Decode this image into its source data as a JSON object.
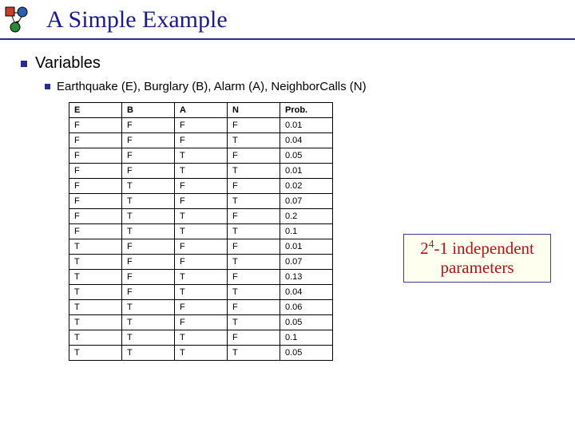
{
  "title": "A Simple Example",
  "bullets": {
    "level1": "Variables",
    "level2": "Earthquake (E), Burglary (B), Alarm (A), NeighborCalls (N)"
  },
  "table": {
    "headers": [
      "E",
      "B",
      "A",
      "N",
      "Prob."
    ],
    "rows": [
      [
        "F",
        "F",
        "F",
        "F",
        "0.01"
      ],
      [
        "F",
        "F",
        "F",
        "T",
        "0.04"
      ],
      [
        "F",
        "F",
        "T",
        "F",
        "0.05"
      ],
      [
        "F",
        "F",
        "T",
        "T",
        "0.01"
      ],
      [
        "F",
        "T",
        "F",
        "F",
        "0.02"
      ],
      [
        "F",
        "T",
        "F",
        "T",
        "0.07"
      ],
      [
        "F",
        "T",
        "T",
        "F",
        "0.2"
      ],
      [
        "F",
        "T",
        "T",
        "T",
        "0.1"
      ],
      [
        "T",
        "F",
        "F",
        "F",
        "0.01"
      ],
      [
        "T",
        "F",
        "F",
        "T",
        "0.07"
      ],
      [
        "T",
        "F",
        "T",
        "F",
        "0.13"
      ],
      [
        "T",
        "F",
        "T",
        "T",
        "0.04"
      ],
      [
        "T",
        "T",
        "F",
        "F",
        "0.06"
      ],
      [
        "T",
        "T",
        "F",
        "T",
        "0.05"
      ],
      [
        "T",
        "T",
        "T",
        "F",
        "0.1"
      ],
      [
        "T",
        "T",
        "T",
        "T",
        "0.05"
      ]
    ]
  },
  "callout": {
    "base": "2",
    "exp": "4",
    "rest": "-1 independent parameters"
  },
  "chart_data": {
    "type": "table",
    "title": "Joint probability table over E,B,A,N",
    "columns": [
      "E",
      "B",
      "A",
      "N",
      "Prob."
    ],
    "rows": [
      {
        "E": "F",
        "B": "F",
        "A": "F",
        "N": "F",
        "Prob": 0.01
      },
      {
        "E": "F",
        "B": "F",
        "A": "F",
        "N": "T",
        "Prob": 0.04
      },
      {
        "E": "F",
        "B": "F",
        "A": "T",
        "N": "F",
        "Prob": 0.05
      },
      {
        "E": "F",
        "B": "F",
        "A": "T",
        "N": "T",
        "Prob": 0.01
      },
      {
        "E": "F",
        "B": "T",
        "A": "F",
        "N": "F",
        "Prob": 0.02
      },
      {
        "E": "F",
        "B": "T",
        "A": "F",
        "N": "T",
        "Prob": 0.07
      },
      {
        "E": "F",
        "B": "T",
        "A": "T",
        "N": "F",
        "Prob": 0.2
      },
      {
        "E": "F",
        "B": "T",
        "A": "T",
        "N": "T",
        "Prob": 0.1
      },
      {
        "E": "T",
        "B": "F",
        "A": "F",
        "N": "F",
        "Prob": 0.01
      },
      {
        "E": "T",
        "B": "F",
        "A": "F",
        "N": "T",
        "Prob": 0.07
      },
      {
        "E": "T",
        "B": "F",
        "A": "T",
        "N": "F",
        "Prob": 0.13
      },
      {
        "E": "T",
        "B": "F",
        "A": "T",
        "N": "T",
        "Prob": 0.04
      },
      {
        "E": "T",
        "B": "T",
        "A": "F",
        "N": "F",
        "Prob": 0.06
      },
      {
        "E": "T",
        "B": "T",
        "A": "F",
        "N": "T",
        "Prob": 0.05
      },
      {
        "E": "T",
        "B": "T",
        "A": "T",
        "N": "F",
        "Prob": 0.1
      },
      {
        "E": "T",
        "B": "T",
        "A": "T",
        "N": "T",
        "Prob": 0.05
      }
    ]
  }
}
